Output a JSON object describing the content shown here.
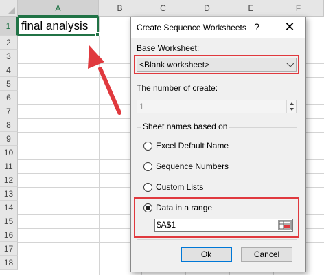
{
  "sheet": {
    "columns": [
      "A",
      "B",
      "C",
      "D",
      "E",
      "F"
    ],
    "rows": [
      "1",
      "2",
      "3",
      "4",
      "5",
      "6",
      "7",
      "8",
      "9",
      "10",
      "11",
      "12",
      "13",
      "14",
      "15",
      "16",
      "17",
      "18"
    ],
    "cell_a1": "final analysis",
    "accent_color": "#217346"
  },
  "annotation": {
    "arrow_color": "#e0393e",
    "highlight_color": "#e0393e"
  },
  "dialog": {
    "title": "Create Sequence Worksheets",
    "help_label": "?",
    "close_label": "✕",
    "base_worksheet_label": "Base Worksheet:",
    "base_worksheet_value": "<Blank worksheet>",
    "number_label": "The number of create:",
    "number_value": "1",
    "group_title": "Sheet names based on",
    "options": [
      {
        "label": "Excel Default Name",
        "selected": false
      },
      {
        "label": "Sequence Numbers",
        "selected": false
      },
      {
        "label": "Custom Lists",
        "selected": false
      },
      {
        "label": "Data in a range",
        "selected": true
      }
    ],
    "range_value": "$A$1",
    "ok_label": "Ok",
    "cancel_label": "Cancel"
  }
}
